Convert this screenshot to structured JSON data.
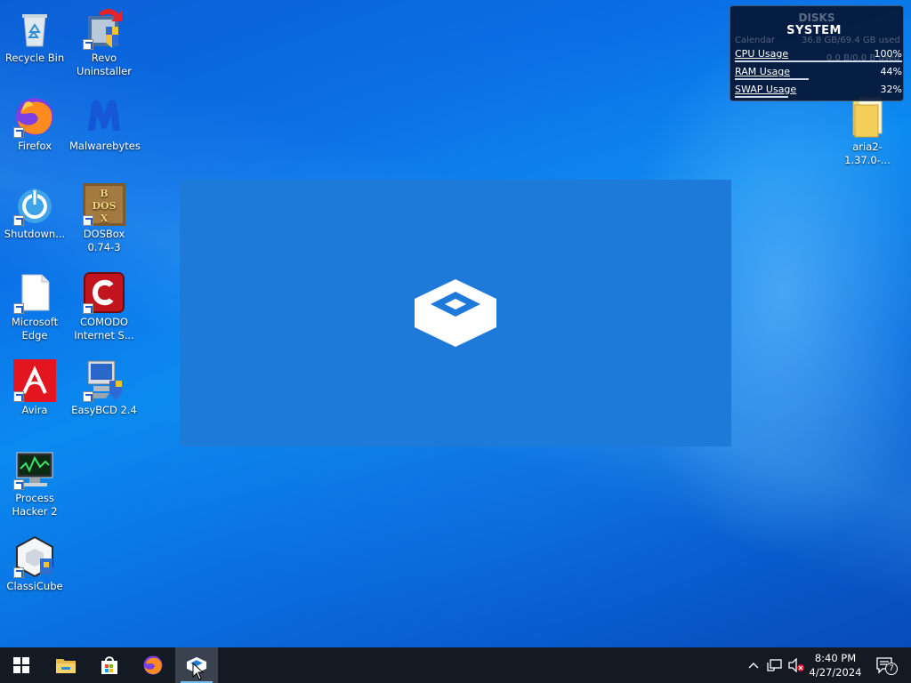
{
  "desktop": {
    "icons": [
      {
        "label": "Recycle Bin",
        "icon": "recycle-bin-icon"
      },
      {
        "label": "Revo Uninstaller",
        "icon": "revo-uninstaller-icon"
      },
      {
        "label": "Firefox",
        "icon": "firefox-icon"
      },
      {
        "label": "Malwarebytes",
        "icon": "malwarebytes-icon"
      },
      {
        "label": "Shutdown...",
        "icon": "shutdown-icon"
      },
      {
        "label": "DOSBox 0.74-3",
        "icon": "dosbox-icon"
      },
      {
        "label": "Microsoft Edge",
        "icon": "blank-document-icon"
      },
      {
        "label": "COMODO Internet S...",
        "icon": "comodo-icon"
      },
      {
        "label": "Avira",
        "icon": "avira-icon"
      },
      {
        "label": "EasyBCD 2.4",
        "icon": "easybcd-icon"
      },
      {
        "label": "Process Hacker 2",
        "icon": "process-hacker-icon"
      },
      {
        "label": "ClassiCube",
        "icon": "classicube-icon"
      },
      {
        "label": "aria2-1.37.0-...",
        "icon": "folder-icon"
      }
    ]
  },
  "widget": {
    "bg_title": "DISKS",
    "title": "SYSTEM",
    "ghost_lines": [
      "Calendar",
      "36.8 GB/69.4 GB used",
      "0.0 B/0.0 B used"
    ],
    "rows": [
      {
        "label": "CPU Usage",
        "value": "100%",
        "level": 1.0
      },
      {
        "label": "RAM Usage",
        "value": "44%",
        "level": 0.44
      },
      {
        "label": "SWAP Usage",
        "value": "32%",
        "level": 0.32
      }
    ]
  },
  "taskbar": {
    "items": [
      "start-icon",
      "file-explorer-icon",
      "microsoft-store-icon",
      "firefox-icon",
      "sandbox-app-icon"
    ],
    "active_item": "sandbox-app-icon"
  },
  "tray": {
    "time": "8:40 PM",
    "date": "4/27/2024",
    "notification_count": "7",
    "icons": [
      "chevron-up-icon",
      "network-icon",
      "volume-muted-icon",
      "notification-icon"
    ]
  },
  "colors": {
    "splash_bg": "#1e7ad8",
    "taskbar_bg": "#141a24",
    "accent": "#76b9ed"
  }
}
